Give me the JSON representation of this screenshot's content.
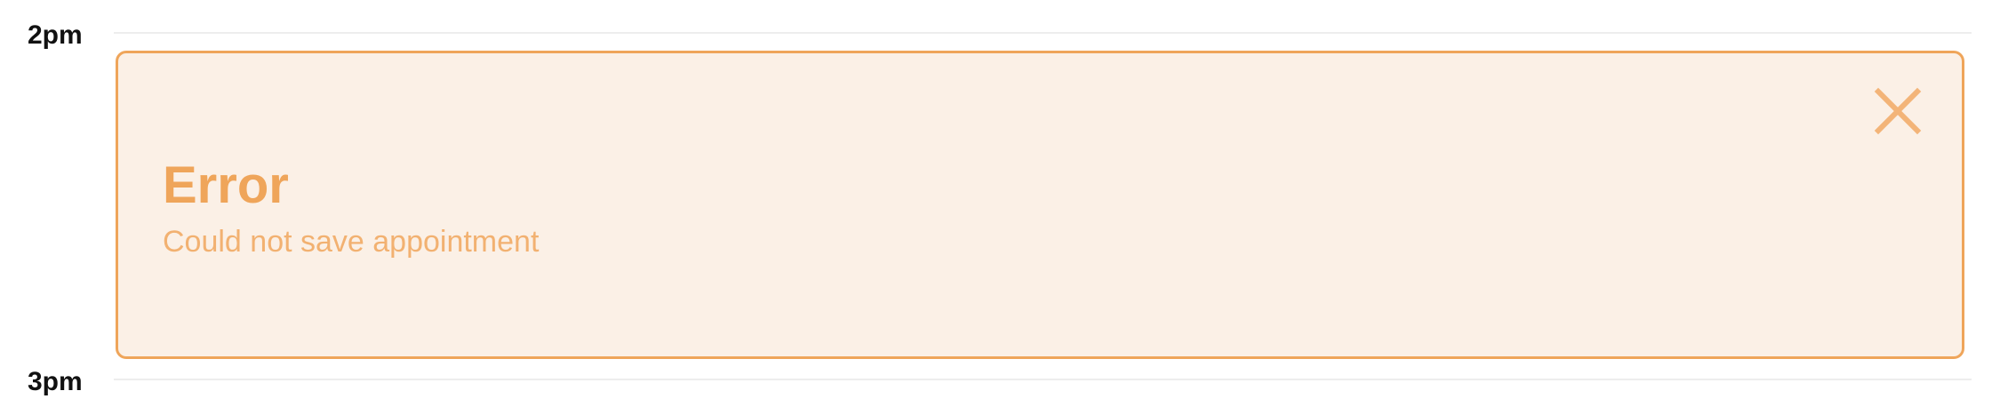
{
  "timeline": {
    "hours": [
      "2pm",
      "3pm"
    ]
  },
  "alert": {
    "title": "Error",
    "message": "Could not save appointment",
    "close_icon": "close-icon",
    "colors": {
      "border": "#efa55a",
      "background": "#fbf0e6",
      "title": "#efa55a",
      "message": "#f2b171",
      "close_icon": "#f3b478"
    }
  }
}
